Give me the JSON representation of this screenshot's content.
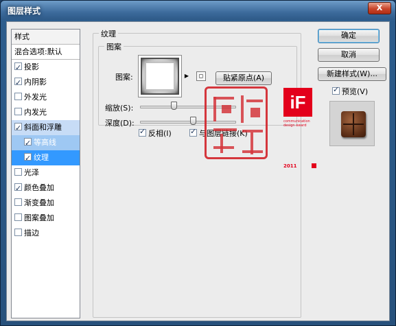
{
  "window": {
    "title": "图层样式",
    "close_label": "X"
  },
  "style_list": {
    "header": "样式",
    "blend_options": "混合选项:默认",
    "items": [
      {
        "label": "投影",
        "checked": true
      },
      {
        "label": "内阴影",
        "checked": true
      },
      {
        "label": "外发光",
        "checked": false
      },
      {
        "label": "内发光",
        "checked": false
      },
      {
        "label": "斜面和浮雕",
        "checked": true
      },
      {
        "label": "等高线",
        "checked": true
      },
      {
        "label": "纹理",
        "checked": true
      },
      {
        "label": "光泽",
        "checked": false
      },
      {
        "label": "颜色叠加",
        "checked": true
      },
      {
        "label": "渐变叠加",
        "checked": false
      },
      {
        "label": "图案叠加",
        "checked": false
      },
      {
        "label": "描边",
        "checked": false
      }
    ]
  },
  "texture_panel": {
    "group_title": "纹理",
    "pattern_group_title": "图案",
    "pattern_label": "图案:",
    "snap_button": "贴紧原点(A)",
    "scale_label": "缩放(S):",
    "scale_value_fraction": 0.35,
    "depth_label": "深度(D):",
    "depth_value_fraction": 0.55,
    "invert_label": "反相(I)",
    "invert_checked": true,
    "link_label": "与图层链接(K)",
    "link_checked": true
  },
  "actions": {
    "ok": "确定",
    "cancel": "取消",
    "new_style": "新建样式(W)...",
    "preview_label": "预览(V)",
    "preview_checked": true
  },
  "watermark": {
    "logo_text": "iF",
    "logo_caption": "communication design award",
    "logo_year": "2011",
    "brand_color": "#e3001b",
    "seal_color": "#d2232a"
  },
  "colors": {
    "selection": "#3399ff",
    "title_bar": "#3d6b9c"
  }
}
